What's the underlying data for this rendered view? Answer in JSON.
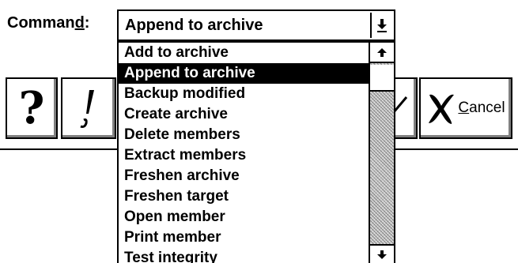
{
  "dialog": {
    "command_label_prefix": "Comman",
    "command_label_mnemonic": "d",
    "command_label_suffix": ":",
    "combo_value": "Append to archive",
    "combo_arrow_icon": "dropdown-arrow-icon"
  },
  "toolbar": {
    "help_icon": "question-mark-icon",
    "bang_icon": "exclamation-icon",
    "ok_icon": "check-icon",
    "cancel_icon": "x-mark-icon",
    "cancel_mnemonic": "C",
    "cancel_rest": "ancel"
  },
  "dropdown": {
    "selected_index": 1,
    "items": [
      "Add to archive",
      "Append to archive",
      "Backup modified",
      "Create archive",
      "Delete members",
      "Extract members",
      "Freshen archive",
      "Freshen target",
      "Open member",
      "Print member",
      "Test integrity"
    ],
    "scroll_up_icon": "scroll-up-arrow-icon",
    "scroll_down_icon": "scroll-down-arrow-icon"
  }
}
